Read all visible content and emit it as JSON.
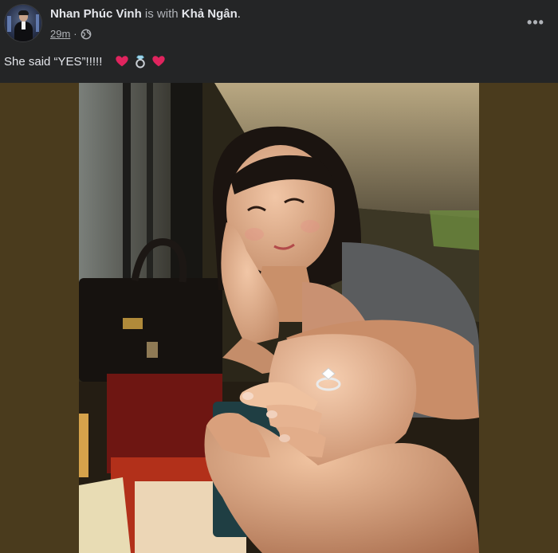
{
  "post": {
    "author_name": "Nhan Phúc Vinh",
    "connector": "is with",
    "tagged_name": "Khả Ngân",
    "end_dot": ".",
    "timestamp": "29m",
    "separator": "·",
    "audience_icon": "globe-icon",
    "more_icon": "•••",
    "caption": "She said “YES”!!!!!",
    "caption_emojis": [
      "red-heart",
      "ring",
      "red-heart"
    ]
  },
  "colors": {
    "background": "#242526",
    "text_primary": "#e4e6eb",
    "text_secondary": "#b0b3b8",
    "photo_side_fill": "#4a3b1d",
    "heart": "#e0245e"
  }
}
